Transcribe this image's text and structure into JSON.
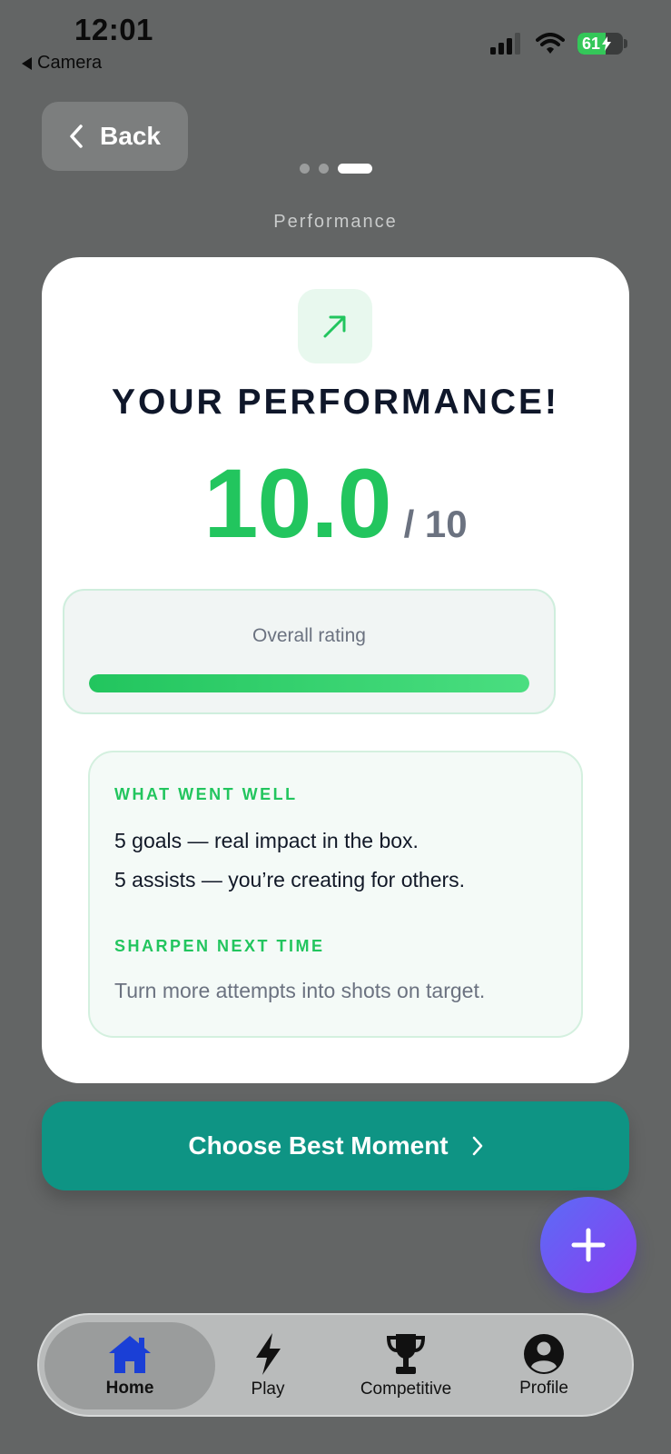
{
  "status_bar": {
    "time": "12:01",
    "back_app": "Camera",
    "battery": "61"
  },
  "nav": {
    "back_label": "Back"
  },
  "pager": {
    "total": 3,
    "active_index": 2,
    "page_label": "Performance"
  },
  "card": {
    "title": "YOUR PERFORMANCE!",
    "score": "10.0",
    "score_max": "/ 10",
    "rating_label": "Overall rating",
    "rating_fraction": 1.0,
    "went_well_heading": "WHAT WENT WELL",
    "went_well": [
      "5 goals — real impact in the box.",
      "5 assists — you’re creating for others."
    ],
    "sharpen_heading": "SHARPEN NEXT TIME",
    "sharpen": [
      "Turn more attempts into shots on target."
    ]
  },
  "cta": {
    "label": "Choose Best Moment"
  },
  "tabbar": {
    "tabs": [
      {
        "label": "Home",
        "icon": "home-icon",
        "active": true
      },
      {
        "label": "Play",
        "icon": "bolt-icon",
        "active": false
      },
      {
        "label": "Competitive",
        "icon": "trophy-icon",
        "active": false
      },
      {
        "label": "Profile",
        "icon": "profile-icon",
        "active": false
      }
    ]
  },
  "colors": {
    "accent_green": "#22c55e",
    "cta_teal": "#0e9484",
    "home_blue": "#1a3fd6",
    "fab_gradient": [
      "#5b6cf6",
      "#8b3cf0"
    ]
  }
}
